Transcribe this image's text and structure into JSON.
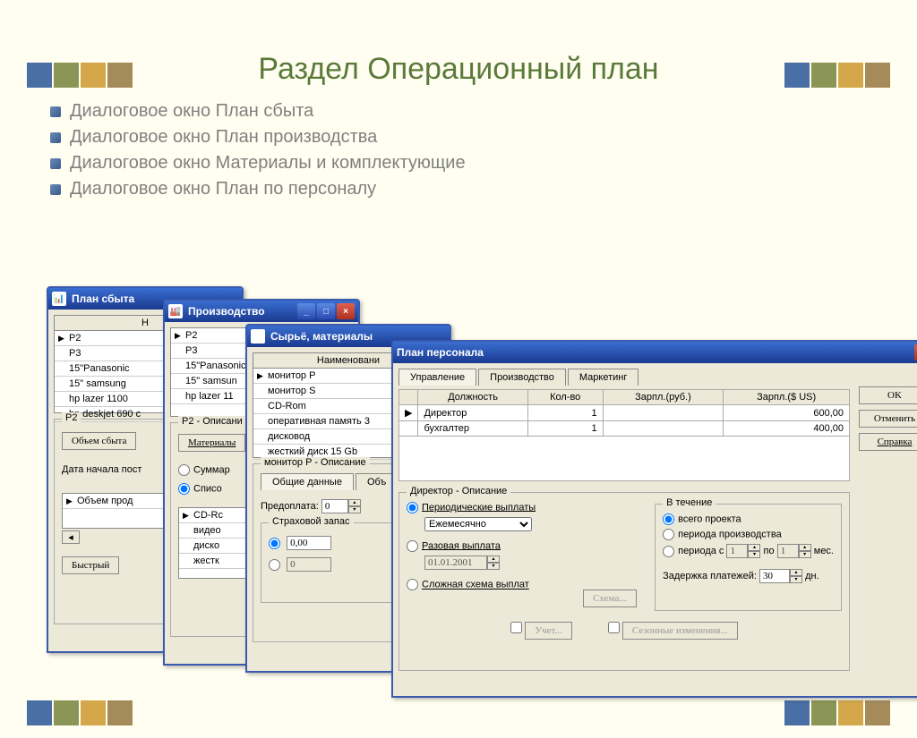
{
  "title": "Раздел Операционный план",
  "bullets": [
    "Диалоговое окно План сбыта",
    "Диалоговое окно План производства",
    "Диалоговое окно Материалы и комплектующие",
    "Диалоговое окно План по персоналу"
  ],
  "w1": {
    "title": "План сбыта",
    "items": [
      "P2",
      "P3",
      "15\"Panasonic",
      "15\" samsung",
      "hp lazer 1100",
      "hp deskjet 690 c"
    ],
    "below": "P2",
    "vol": "Объем сбыта",
    "start": "Дата начала пост",
    "row1": "Объем прод",
    "quick": "Быстрый"
  },
  "w2": {
    "title": "Производство",
    "items": [
      "P2",
      "P3",
      "15\"Panasonic",
      "15\" samsun",
      "hp lazer 11"
    ],
    "desc": "P2 - Описани",
    "mat": "Материалы",
    "sum": "Суммар",
    "list": "Списо",
    "rows": [
      "CD-Rс",
      "видео",
      "диско",
      "жестк"
    ]
  },
  "w3": {
    "title": "Сырьё, материалы",
    "header": "Наименовани",
    "items": [
      "монитор P",
      "монитор S",
      "CD-Rom",
      "оперативная память 3",
      "дисковод",
      "жесткий диск 15 Gb"
    ],
    "desc": "монитор P - Описание",
    "tab1": "Общие данные",
    "tab2": "Объ",
    "pre": "Предоплата:",
    "preval": "0",
    "stock": "Страховой запас",
    "val1": "0,00",
    "val2": "0"
  },
  "w4": {
    "title": "План персонала",
    "tabs": [
      "Управление",
      "Производство",
      "Маркетинг"
    ],
    "cols": [
      "Должность",
      "Кол-во",
      "Зарпл.(руб.)",
      "Зарпл.($ US)"
    ],
    "rows": [
      {
        "pos": "Директор",
        "qty": "1",
        "rub": "",
        "usd": "600,00"
      },
      {
        "pos": "бухгалтер",
        "qty": "1",
        "rub": "",
        "usd": "400,00"
      }
    ],
    "ok": "OK",
    "cancel": "Отменить",
    "help": "Справка",
    "group": "Директор - Описание",
    "periodic": "Периодические выплаты",
    "freq": "Ежемесячно",
    "once": "Разовая выплата",
    "date": "01.01.2001",
    "complex": "Сложная схема выплат",
    "scheme": "Схема...",
    "duration": "В течение",
    "all": "всего проекта",
    "prod": "периода производства",
    "from": "периода с",
    "to": "по",
    "mo": "мес.",
    "delay": "Задержка платежей:",
    "delayval": "30",
    "days": "дн.",
    "acct": "Учет...",
    "season": "Сезонные изменения..."
  }
}
